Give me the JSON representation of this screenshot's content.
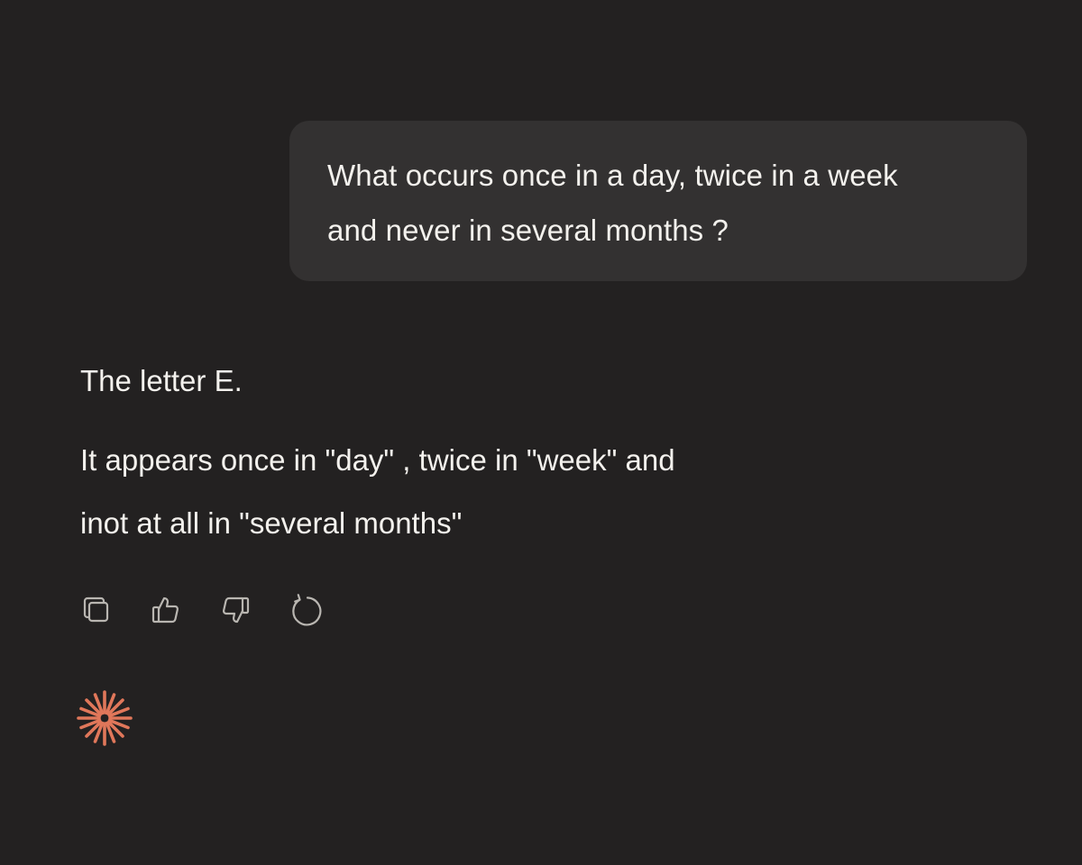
{
  "conversation": {
    "user_message": "What occurs once in a day, twice in a week\nand never in several months ?",
    "assistant_answer": "The letter E.",
    "assistant_explanation_line1": "It appears once in \"day\" , twice in \"week\" and",
    "assistant_explanation_line2": "inot at all in \"several months\""
  },
  "actions": {
    "icons": [
      "copy-icon",
      "thumbs-up-icon",
      "thumbs-down-icon",
      "retry-icon"
    ]
  },
  "brand": {
    "icon": "spark-icon",
    "accent_color": "#e0775a"
  },
  "theme": {
    "background": "#232121",
    "bubble": "#333131",
    "text": "#f3f1ed",
    "icon_stroke": "#b9b6b1"
  }
}
